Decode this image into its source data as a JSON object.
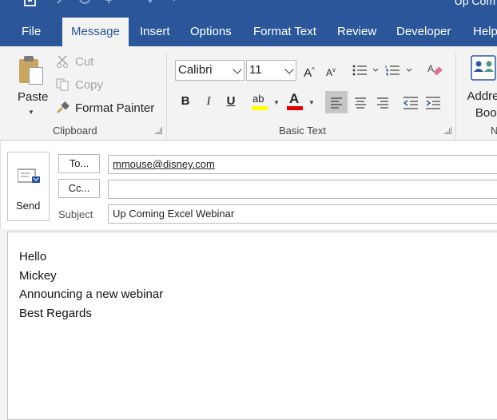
{
  "title_bar": {
    "title": "Up Com"
  },
  "tabs": [
    {
      "label": "File"
    },
    {
      "label": "Message"
    },
    {
      "label": "Insert"
    },
    {
      "label": "Options"
    },
    {
      "label": "Format Text"
    },
    {
      "label": "Review"
    },
    {
      "label": "Developer"
    },
    {
      "label": "Help"
    }
  ],
  "ribbon": {
    "clipboard": {
      "paste": "Paste",
      "cut": "Cut",
      "copy": "Copy",
      "format_painter": "Format Painter",
      "group_label": "Clipboard"
    },
    "basic_text": {
      "font": "Calibri",
      "size": "11",
      "grow_font": "A",
      "shrink_font": "A",
      "bold": "B",
      "italic": "I",
      "underline": "U",
      "highlight": "ab",
      "font_color": "A",
      "group_label": "Basic Text"
    },
    "names": {
      "address_book": "Address Book",
      "check_names": "N"
    }
  },
  "compose": {
    "send": "Send",
    "to_button": "To...",
    "cc_button": "Cc...",
    "subject_label": "Subject",
    "to_value": "mmouse@disney.com",
    "cc_value": "",
    "subject_value": "Up Coming Excel Webinar",
    "body_lines": [
      "Hello",
      "Mickey",
      "Announcing a new webinar",
      "Best Regards"
    ]
  },
  "colors": {
    "accent": "#2b579a",
    "highlight_yellow": "#ffff00",
    "font_color_red": "#e00000"
  }
}
